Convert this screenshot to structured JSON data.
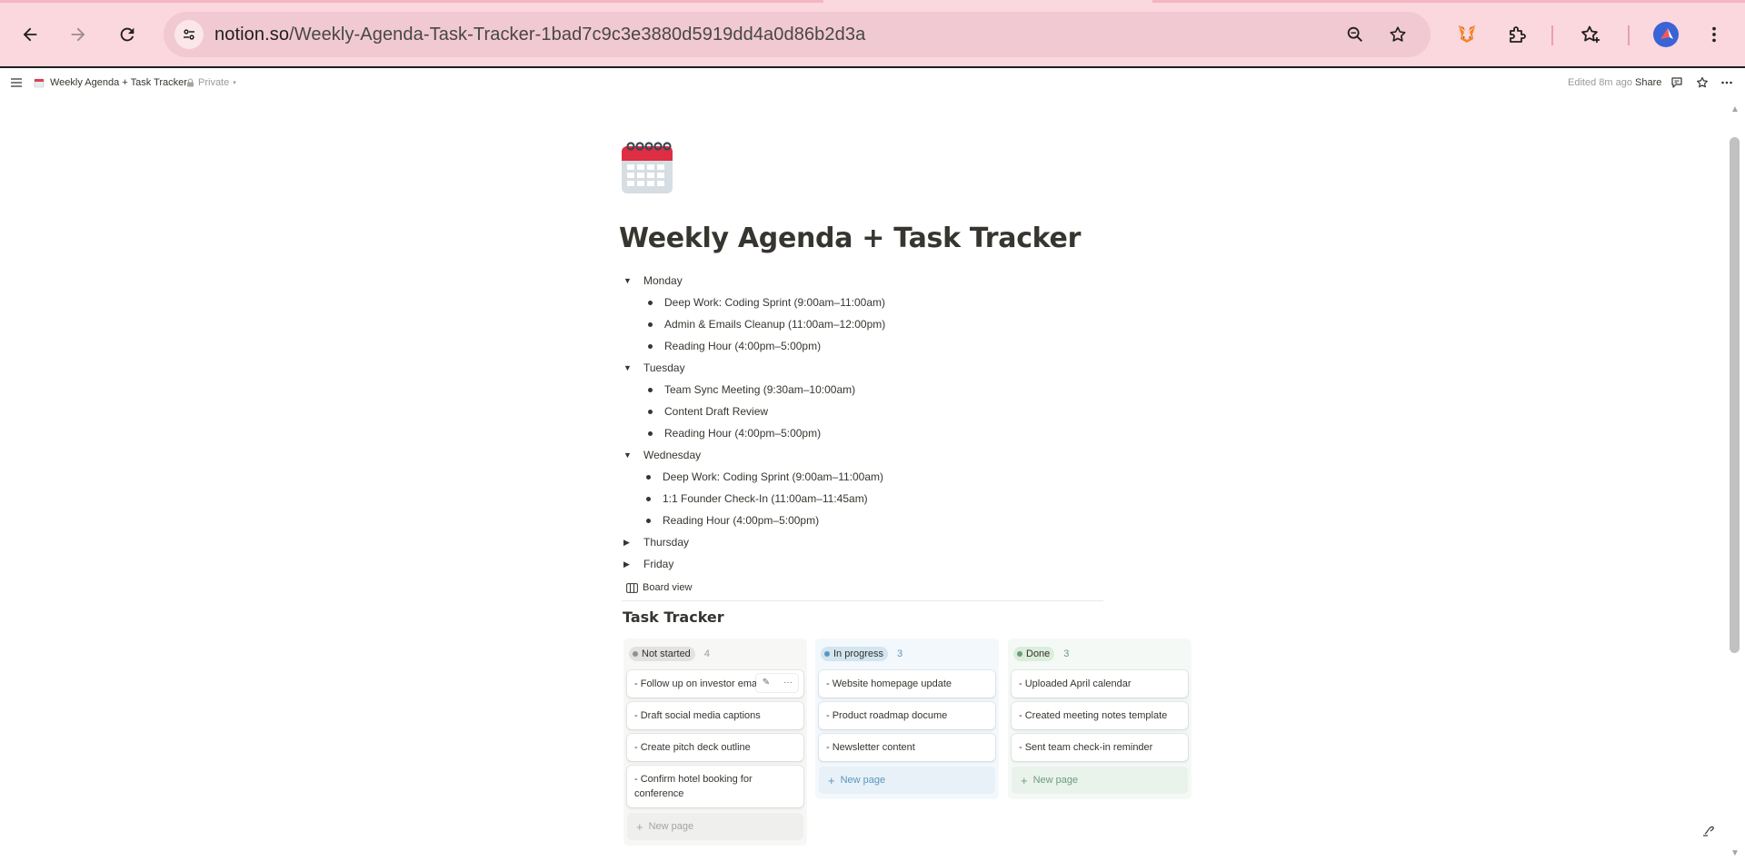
{
  "browser": {
    "url_host": "notion.so",
    "url_path": "/Weekly-Agenda-Task-Tracker-1bad7c9c3e3880d5919dd4a0d86b2d3a",
    "colors": {
      "frame": "#fbd7de",
      "omnibox": "#f1c9d2"
    },
    "icons": [
      "back-icon",
      "forward-icon",
      "reload-icon",
      "tune-icon",
      "zoom-icon",
      "bookmark-star-icon",
      "metamask-fox-icon",
      "extensions-puzzle-icon",
      "bookmarks-star-icon",
      "profile-avatar-icon",
      "kebab-menu-icon"
    ]
  },
  "topbar": {
    "page_name": "Weekly Agenda + Task Tracker",
    "privacy": "Private",
    "edited": "Edited 8m ago",
    "share": "Share"
  },
  "page": {
    "icon": "calendar-icon",
    "title": "Weekly Agenda + Task Tracker",
    "days": [
      {
        "name": "Monday",
        "expanded": true,
        "items": [
          "Deep Work: Coding Sprint (9:00am–11:00am)",
          "Admin & Emails Cleanup (11:00am–12:00pm)",
          "Reading Hour (4:00pm–5:00pm)"
        ]
      },
      {
        "name": "Tuesday",
        "expanded": true,
        "items": [
          "Team Sync Meeting (9:30am–10:00am)",
          "Content Draft Review",
          "Reading Hour (4:00pm–5:00pm)"
        ]
      },
      {
        "name": "Wednesday",
        "expanded": true,
        "items": [
          "Deep Work: Coding Sprint (9:00am–11:00am)",
          "1:1 Founder Check-In (11:00am–11:45am)",
          "Reading Hour (4:00pm–5:00pm)"
        ]
      },
      {
        "name": "Thursday",
        "expanded": false,
        "items": []
      },
      {
        "name": "Friday",
        "expanded": false,
        "items": []
      }
    ]
  },
  "database": {
    "view_label": "Board view",
    "title": "Task Tracker",
    "columns": [
      {
        "status": "Not started",
        "count": "4",
        "colors": {
          "bg": "#f7f7f5",
          "pill": "#e3e2e0",
          "dot": "#91918e",
          "count": "#9b9a97",
          "new": "#a5a4a1"
        },
        "cards": [
          "- Follow up on investor emai",
          "- Draft social media captions",
          "- Create pitch deck outline",
          "- Confirm hotel booking for conference"
        ],
        "new_page": "New page"
      },
      {
        "status": "In progress",
        "count": "3",
        "colors": {
          "bg": "#f3f8fc",
          "pill": "#d3e5ef",
          "dot": "#5b97bd",
          "count": "#5b97bd",
          "new": "#5b97bd"
        },
        "cards": [
          "- Website homepage update",
          "- Product roadmap docume",
          "- Newsletter content"
        ],
        "new_page": "New page"
      },
      {
        "status": "Done",
        "count": "3",
        "colors": {
          "bg": "#f4f9f6",
          "pill": "#dbeddb",
          "dot": "#6c9b7d",
          "count": "#6c9b7d",
          "new": "#6c9b7d"
        },
        "cards": [
          "- Uploaded April calendar",
          "- Created meeting notes template",
          "- Sent team check-in reminder"
        ],
        "new_page": "New page"
      }
    ]
  }
}
